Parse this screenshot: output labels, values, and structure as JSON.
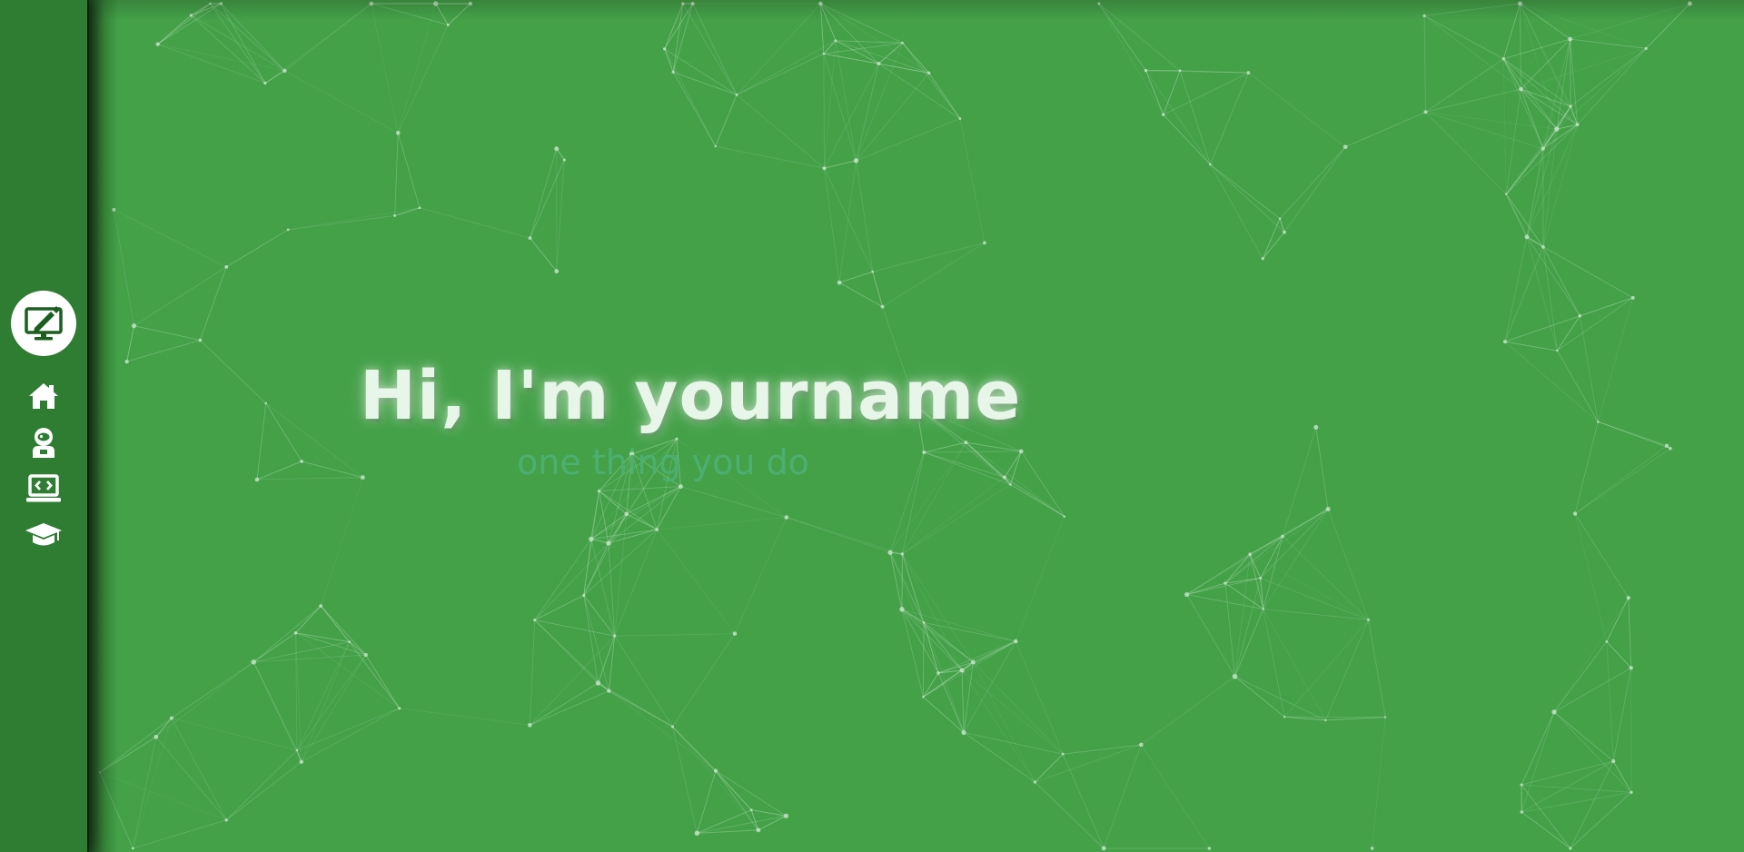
{
  "hero": {
    "title": "Hi, I'm yourname",
    "subtitle": "one thing you do"
  },
  "sidebar": {
    "logo_icon": "monitor-pen-icon",
    "items": [
      {
        "id": "home",
        "icon": "home-icon"
      },
      {
        "id": "about",
        "icon": "astronaut-icon"
      },
      {
        "id": "projects",
        "icon": "laptop-code-icon"
      },
      {
        "id": "education",
        "icon": "graduation-cap-icon"
      }
    ]
  },
  "colors": {
    "background": "#44a148",
    "sidebar": "#2e7d32",
    "accent": "#1b5e20",
    "title": "#e8f5e9",
    "subtitle": "#4caf72",
    "particles": "#c8e6c9"
  }
}
